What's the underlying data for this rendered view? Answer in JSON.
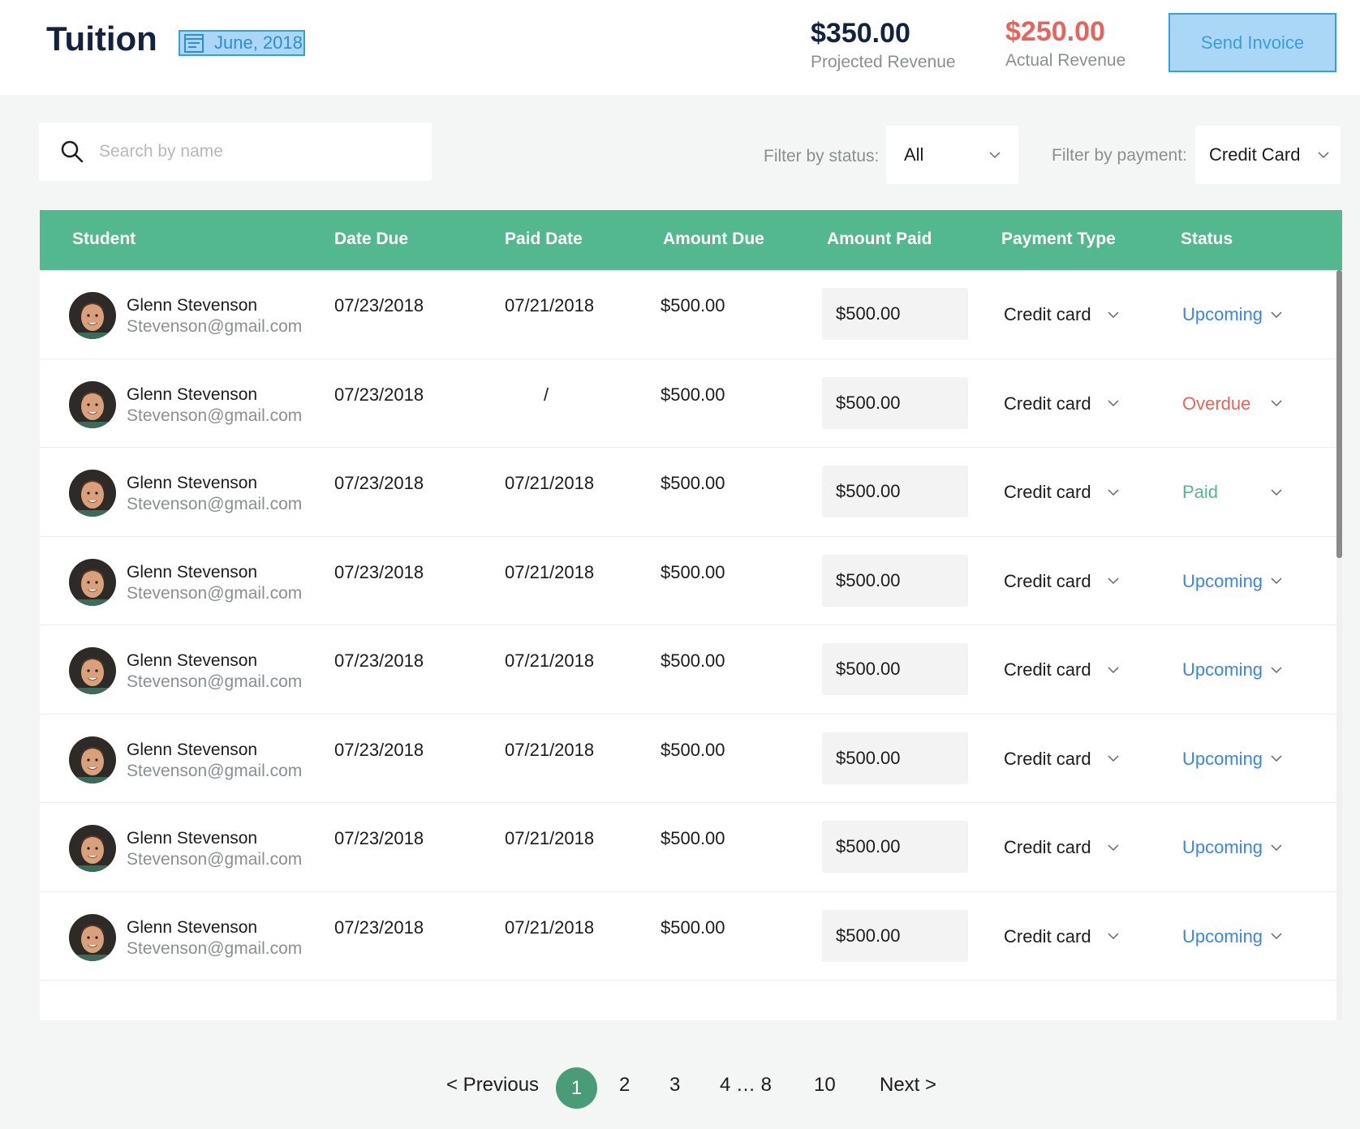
{
  "header": {
    "title": "Tuition",
    "date": "June, 2018",
    "projected_value": "$350.00",
    "projected_label": "Projected Revenue",
    "actual_value": "$250.00",
    "actual_label": "Actual Revenue",
    "send_invoice": "Send Invoice"
  },
  "filters": {
    "search_placeholder": "Search by name",
    "status_label": "Filter by status:",
    "status_value": "All",
    "payment_label": "Filter by payment:",
    "payment_value": "Credit Card"
  },
  "table": {
    "columns": [
      "Student",
      "Date Due",
      "Paid Date",
      "Amount Due",
      "Amount Paid",
      "Payment Type",
      "Status"
    ],
    "rows": [
      {
        "name": "Glenn Stevenson",
        "email": "Stevenson@gmail.com",
        "date_due": "07/23/2018",
        "paid_date": "07/21/2018",
        "amount_due": "$500.00",
        "amount_paid": "$500.00",
        "payment_type": "Credit card",
        "status": "Upcoming"
      },
      {
        "name": "Glenn Stevenson",
        "email": "Stevenson@gmail.com",
        "date_due": "07/23/2018",
        "paid_date": "/",
        "amount_due": "$500.00",
        "amount_paid": "$500.00",
        "payment_type": "Credit card",
        "status": "Overdue"
      },
      {
        "name": "Glenn Stevenson",
        "email": "Stevenson@gmail.com",
        "date_due": "07/23/2018",
        "paid_date": "07/21/2018",
        "amount_due": "$500.00",
        "amount_paid": "$500.00",
        "payment_type": "Credit card",
        "status": "Paid"
      },
      {
        "name": "Glenn Stevenson",
        "email": "Stevenson@gmail.com",
        "date_due": "07/23/2018",
        "paid_date": "07/21/2018",
        "amount_due": "$500.00",
        "amount_paid": "$500.00",
        "payment_type": "Credit card",
        "status": "Upcoming"
      },
      {
        "name": "Glenn Stevenson",
        "email": "Stevenson@gmail.com",
        "date_due": "07/23/2018",
        "paid_date": "07/21/2018",
        "amount_due": "$500.00",
        "amount_paid": "$500.00",
        "payment_type": "Credit card",
        "status": "Upcoming"
      },
      {
        "name": "Glenn Stevenson",
        "email": "Stevenson@gmail.com",
        "date_due": "07/23/2018",
        "paid_date": "07/21/2018",
        "amount_due": "$500.00",
        "amount_paid": "$500.00",
        "payment_type": "Credit card",
        "status": "Upcoming"
      },
      {
        "name": "Glenn Stevenson",
        "email": "Stevenson@gmail.com",
        "date_due": "07/23/2018",
        "paid_date": "07/21/2018",
        "amount_due": "$500.00",
        "amount_paid": "$500.00",
        "payment_type": "Credit card",
        "status": "Upcoming"
      },
      {
        "name": "Glenn Stevenson",
        "email": "Stevenson@gmail.com",
        "date_due": "07/23/2018",
        "paid_date": "07/21/2018",
        "amount_due": "$500.00",
        "amount_paid": "$500.00",
        "payment_type": "Credit card",
        "status": "Upcoming"
      }
    ]
  },
  "pagination": {
    "previous": "< Previous",
    "current": "1",
    "pages": [
      "2",
      "3",
      "4 … 8",
      "10"
    ],
    "next": "Next >"
  },
  "colors": {
    "table_header": "#53b88f",
    "status_upcoming": "#3a86e0",
    "status_overdue": "#e5645e",
    "status_paid": "#53b88f",
    "actual_revenue": "#e5645e",
    "accent_blue": "#3a9ed9",
    "pagination_active": "#4a9b77"
  },
  "icons": {
    "search": "search-icon",
    "calendar": "calendar-icon",
    "chevron": "chevron-down-icon",
    "avatar": "avatar"
  }
}
